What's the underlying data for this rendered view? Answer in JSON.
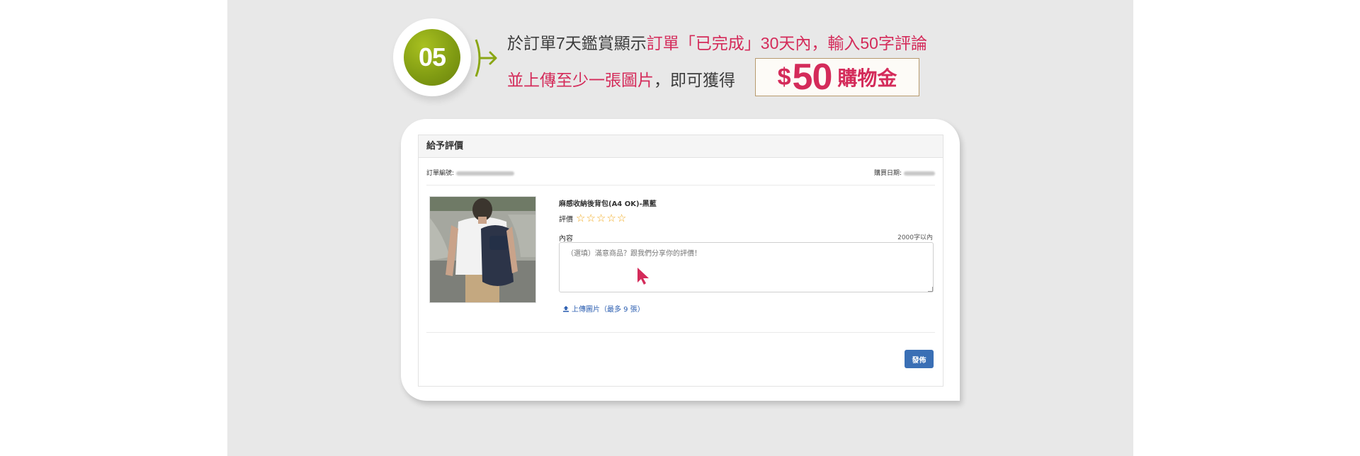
{
  "step": {
    "number": "05",
    "line1_part1": "於訂單7天鑑賞顯示",
    "line1_part2": "訂單「已完成」30天內，輸入50字評論",
    "line2_part1": "並上傳至少一張圖片",
    "line2_part2": "，即可獲得",
    "reward_currency": "$",
    "reward_amount": "50",
    "reward_text": "購物金"
  },
  "colors": {
    "accent": "#d42b5a",
    "badge": "#8aa614",
    "button": "#3a6fb5",
    "star": "#f0a81c"
  },
  "form": {
    "title": "給予評價",
    "order_no_label": "訂單編號:",
    "purchase_date_label": "購買日期:",
    "product_name": "麻感收納後背包(A4 OK)-黑藍",
    "rating_label": "評價",
    "stars": 5,
    "stars_filled": 0,
    "content_label": "內容",
    "content_limit": "2000字以內",
    "content_placeholder": "（選填）滿意商品？跟我們分享你的評價！",
    "upload_label": "上傳圖片（最多 9 張）",
    "submit_label": "發佈"
  }
}
